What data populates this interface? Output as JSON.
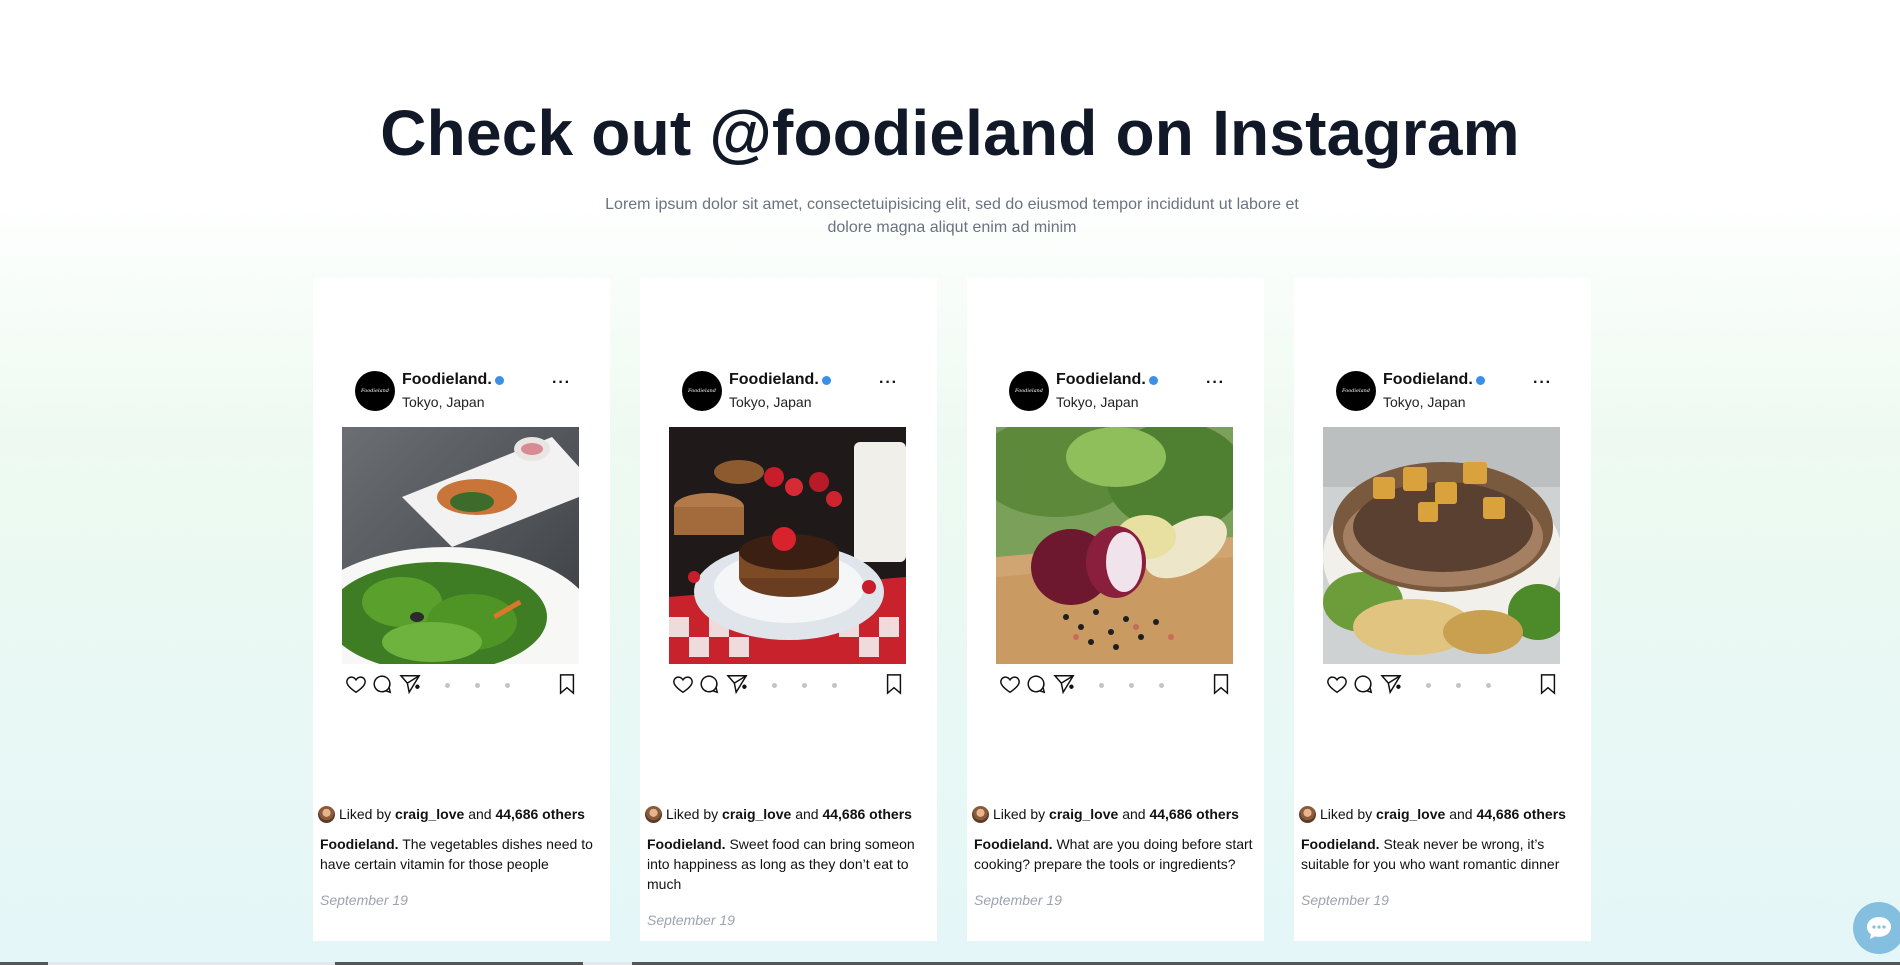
{
  "section": {
    "heading": "Check out @foodieland on Instagram",
    "subtitle": "Lorem ipsum dolor sit amet, consectetuipisicing elit, sed do eiusmod tempor incididunt ut labore et dolore magna aliqut enim ad minim"
  },
  "posts": [
    {
      "account": "Foodieland.",
      "logo_text": "Foodieland",
      "location": "Tokyo, Japan",
      "photo": "salad",
      "liked_by_prefix": "Liked by",
      "liked_by_user": "craig_love",
      "liked_by_and": "and",
      "liked_by_count": "44,686 others",
      "caption_author": "Foodieland.",
      "caption": "The vegetables dishes need to have certain vitamin for those people",
      "date": "September 19"
    },
    {
      "account": "Foodieland.",
      "logo_text": "Foodieland",
      "location": "Tokyo, Japan",
      "photo": "pancakes",
      "liked_by_prefix": "Liked by",
      "liked_by_user": "craig_love",
      "liked_by_and": "and",
      "liked_by_count": "44,686 others",
      "caption_author": "Foodieland.",
      "caption": "Sweet food can bring someon into happiness as long as they don’t eat to much",
      "date": "September 19"
    },
    {
      "account": "Foodieland.",
      "logo_text": "Foodieland",
      "location": "Tokyo, Japan",
      "photo": "vegetables",
      "liked_by_prefix": "Liked by",
      "liked_by_user": "craig_love",
      "liked_by_and": "and",
      "liked_by_count": "44,686 others",
      "caption_author": "Foodieland.",
      "caption": "What are you doing before start cooking? prepare the tools or ingredients?",
      "date": "September 19"
    },
    {
      "account": "Foodieland.",
      "logo_text": "Foodieland",
      "location": "Tokyo, Japan",
      "photo": "steak",
      "liked_by_prefix": "Liked by",
      "liked_by_user": "craig_love",
      "liked_by_and": "and",
      "liked_by_count": "44,686 others",
      "caption_author": "Foodieland.",
      "caption": "Steak never be wrong, it’s suitable for you who want romantic dinner",
      "date": "September 19"
    }
  ],
  "icons": {
    "like": "heart-icon",
    "comment": "comment-icon",
    "share": "send-icon",
    "save": "bookmark-icon",
    "more": "more-icon",
    "chat": "chat-bubble-icon"
  },
  "colors": {
    "heading": "#111827",
    "subtitle": "#6b7280",
    "verified": "#3b8fe8",
    "chat_button": "#85bfe0",
    "date": "#9ca3af"
  }
}
